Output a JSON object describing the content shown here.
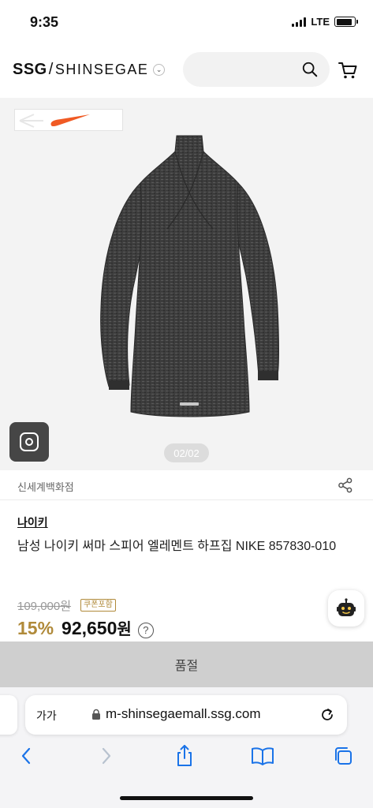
{
  "status_bar": {
    "time": "9:35",
    "network": "LTE",
    "signal_bars": 4,
    "battery_level": 0.9
  },
  "header": {
    "logo_ssg": "SSG",
    "logo_separator": "/",
    "logo_name": "SHINSEGAE",
    "search_placeholder": ""
  },
  "gallery": {
    "page_indicator": "02/02"
  },
  "product": {
    "store": "신세계백화점",
    "brand": "나이키",
    "title": "남성 나이키 써마 스피어 엘레멘트 하프집 NIKE 857830-010",
    "original_price": "109,000원",
    "coupon_badge": "쿠폰포함",
    "discount_rate": "15%",
    "sale_price": "92,650",
    "price_unit": "원",
    "info_symbol": "?",
    "sold_out": "품절"
  },
  "safari": {
    "text_size_label": "가가",
    "url": "m-shinsegaemall.ssg.com"
  },
  "colors": {
    "accent_gold": "#b08a3a",
    "soldout_bg": "#cfcfcf",
    "nike_orange": "#f05a24"
  }
}
